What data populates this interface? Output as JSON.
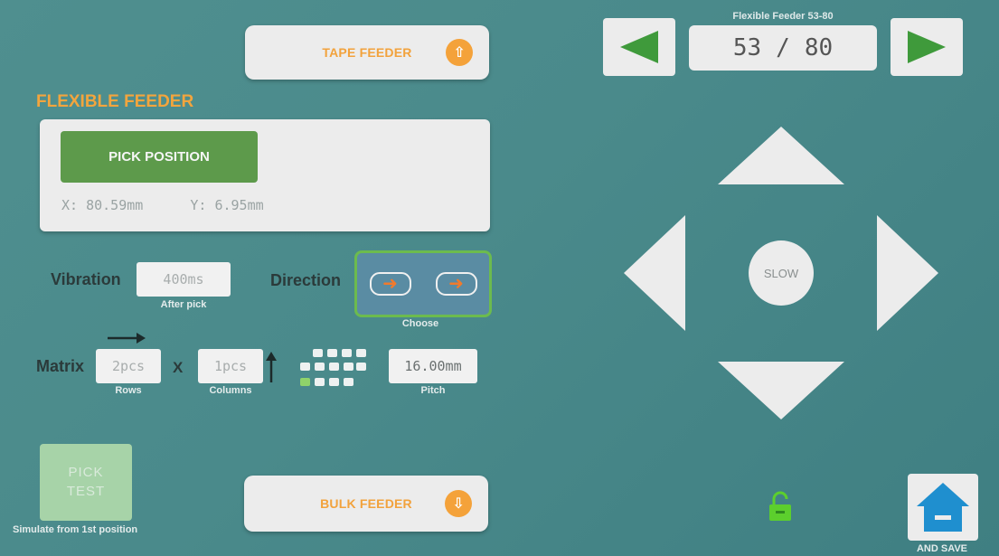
{
  "buttons": {
    "tape_feeder": "TAPE FEEDER",
    "bulk_feeder": "BULK FEEDER",
    "pick_position": "PICK POSITION",
    "slow": "SLOW",
    "pick_test_line1": "PICK",
    "pick_test_line2": "TEST",
    "pick_test_caption": "Simulate from 1st position",
    "home_caption": "AND SAVE"
  },
  "section": {
    "title": "FLEXIBLE FEEDER"
  },
  "position": {
    "x_label": "X:",
    "x_value": "80.59mm",
    "y_label": "Y:",
    "y_value": "6.95mm"
  },
  "vibration": {
    "label": "Vibration",
    "value": "400ms",
    "caption": "After pick"
  },
  "direction": {
    "label": "Direction",
    "caption": "Choose"
  },
  "matrix": {
    "label": "Matrix",
    "rows_value": "2pcs",
    "rows_caption": "Rows",
    "times": "X",
    "columns_value": "1pcs",
    "columns_caption": "Columns",
    "pitch_value": "16.00mm",
    "pitch_caption": "Pitch"
  },
  "navigator": {
    "title": "Flexible Feeder 53-80",
    "current": "53",
    "separator": "/",
    "total": "80"
  },
  "colors": {
    "background": "#4a8a8b",
    "accent_orange": "#f3a53d",
    "accent_green": "#5d9a4b",
    "lock_green": "#5ccf2d"
  },
  "icons": {
    "up": "arrow-up-icon",
    "down": "arrow-down-icon",
    "prev": "play-left-icon",
    "next": "play-right-icon",
    "lock": "unlock-icon",
    "home": "home-icon"
  }
}
